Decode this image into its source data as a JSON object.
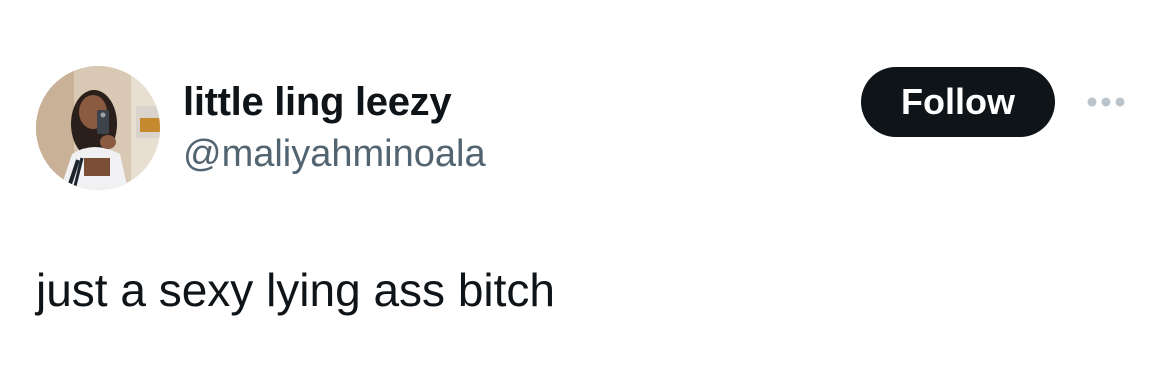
{
  "tweet": {
    "author": {
      "display_name": "little ling leezy",
      "handle": "@maliyahminoala",
      "avatar_icon": "profile-photo"
    },
    "follow_label": "Follow",
    "more_icon": "more-horizontal-icon",
    "text": "just a sexy lying ass bitch"
  },
  "colors": {
    "primary_text": "#0f1419",
    "secondary_text": "#536471",
    "follow_background": "#0f1419",
    "follow_text": "#ffffff",
    "more_icon": "#b9c4cc",
    "background": "#ffffff"
  }
}
